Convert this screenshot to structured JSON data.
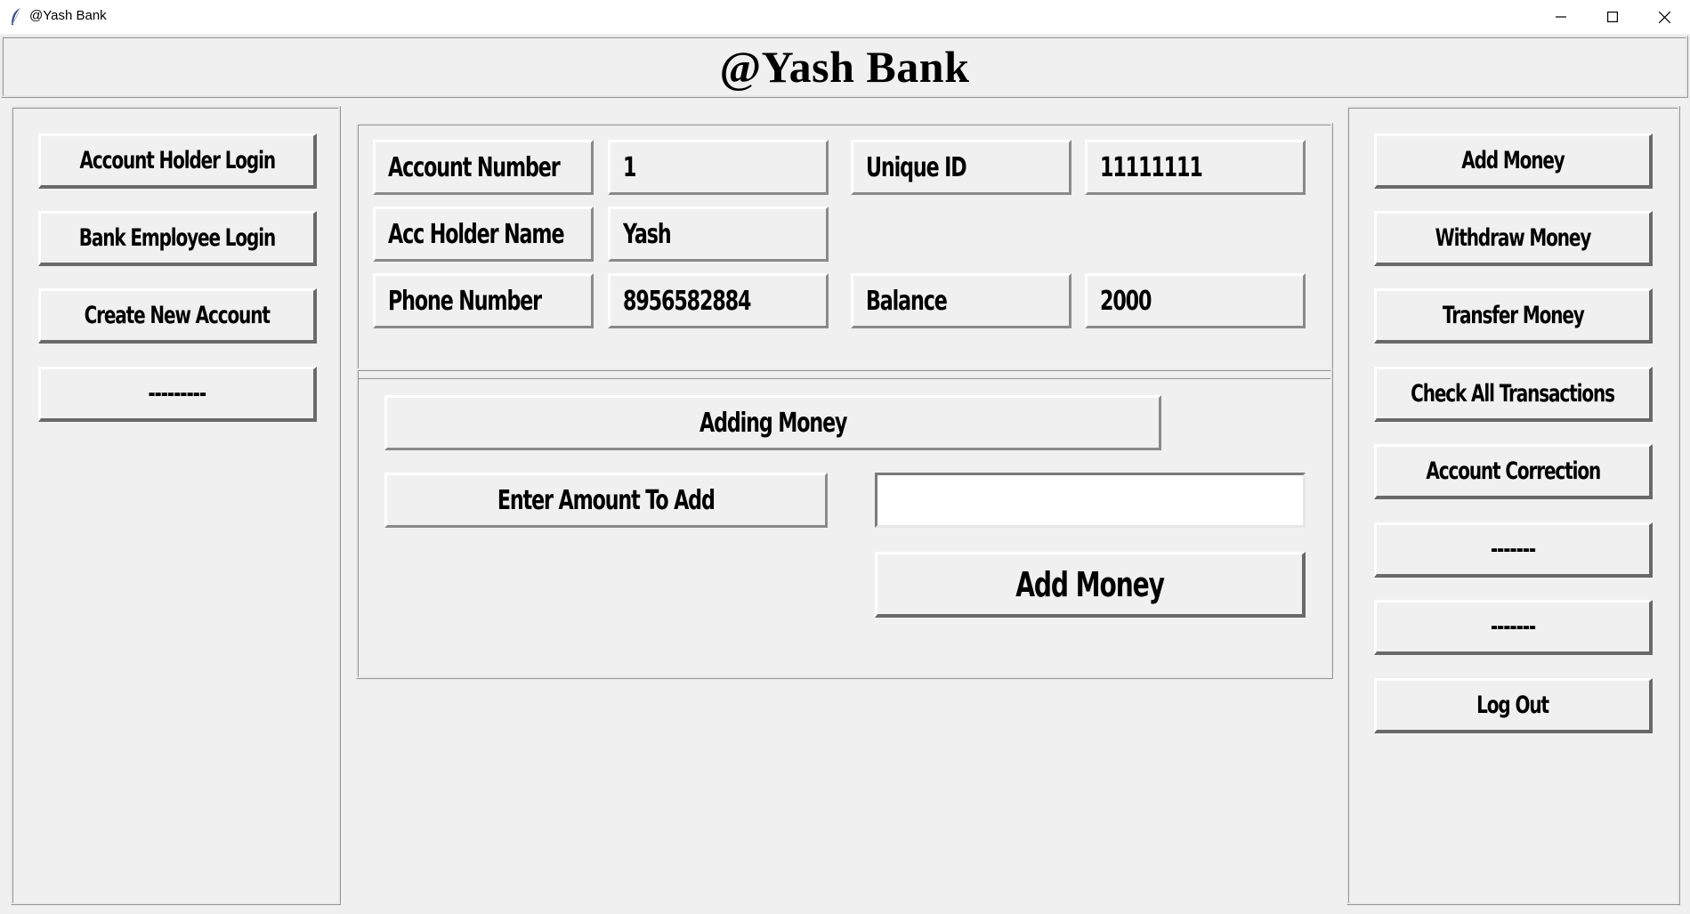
{
  "window": {
    "title": "@Yash Bank",
    "controls": {
      "minimize": "minimize-icon",
      "maximize": "maximize-icon",
      "close": "close-icon"
    }
  },
  "header": {
    "title": "@Yash Bank"
  },
  "left_menu": {
    "items": [
      {
        "label": "Account Holder Login"
      },
      {
        "label": "Bank Employee Login"
      },
      {
        "label": "Create New Account"
      },
      {
        "label": "---------"
      }
    ]
  },
  "account_info": {
    "account_number_label": "Account Number",
    "account_number_value": "1",
    "unique_id_label": "Unique ID",
    "unique_id_value": "11111111",
    "holder_name_label": "Acc Holder Name",
    "holder_name_value": "Yash",
    "phone_label": "Phone Number",
    "phone_value": "8956582884",
    "balance_label": "Balance",
    "balance_value": "2000"
  },
  "add_money_panel": {
    "heading": "Adding Money",
    "amount_label": "Enter Amount To Add",
    "amount_value": "",
    "submit_label": "Add Money"
  },
  "right_menu": {
    "items": [
      {
        "label": "Add Money"
      },
      {
        "label": "Withdraw Money"
      },
      {
        "label": "Transfer Money"
      },
      {
        "label": "Check All Transactions"
      },
      {
        "label": "Account Correction"
      },
      {
        "label": "-------"
      },
      {
        "label": "-------"
      },
      {
        "label": "Log Out"
      }
    ]
  }
}
